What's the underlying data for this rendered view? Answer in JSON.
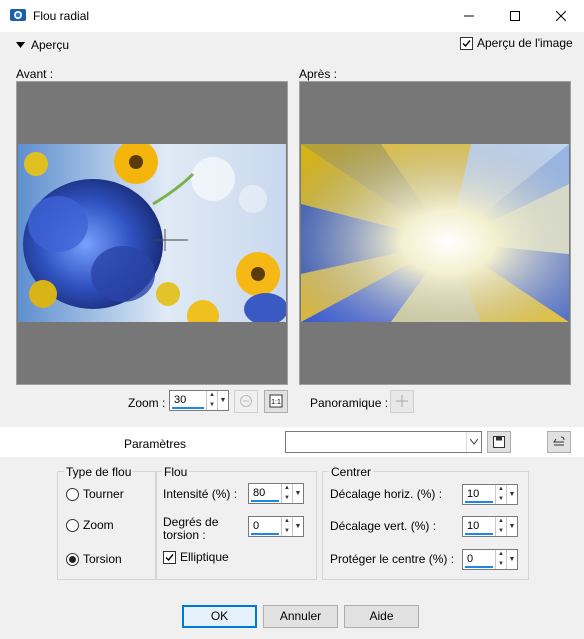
{
  "window": {
    "title": "Flou radial"
  },
  "preview": {
    "toggle_label": "Aperçu",
    "image_preview_label": "Aperçu de l'image",
    "image_preview_checked": true
  },
  "before": {
    "label": "Avant :"
  },
  "after": {
    "label": "Après :"
  },
  "zoom": {
    "label": "Zoom :",
    "value": "30"
  },
  "pan": {
    "label": "Panoramique :"
  },
  "params": {
    "label": "Paramètres",
    "preset_value": ""
  },
  "type_group": {
    "title": "Type de flou",
    "options": [
      "Tourner",
      "Zoom",
      "Torsion"
    ],
    "selected": "Torsion"
  },
  "flou_group": {
    "title": "Flou",
    "intensity_label": "Intensité (%) :",
    "intensity_value": "80",
    "twist_label_1": "Degrés de",
    "twist_label_2": "torsion :",
    "twist_value": "0",
    "elliptic_label": "Elliptique",
    "elliptic_checked": true
  },
  "centre_group": {
    "title": "Centrer",
    "h_label": "Décalage horiz. (%) :",
    "h_value": "10",
    "v_label": "Décalage vert. (%) :",
    "v_value": "10",
    "protect_label": "Protéger le centre (%) :",
    "protect_value": "0"
  },
  "buttons": {
    "ok": "OK",
    "cancel": "Annuler",
    "help": "Aide"
  },
  "colors": {
    "accent": "#0078d7",
    "panel": "#777777",
    "slider": "#1e88e5"
  }
}
